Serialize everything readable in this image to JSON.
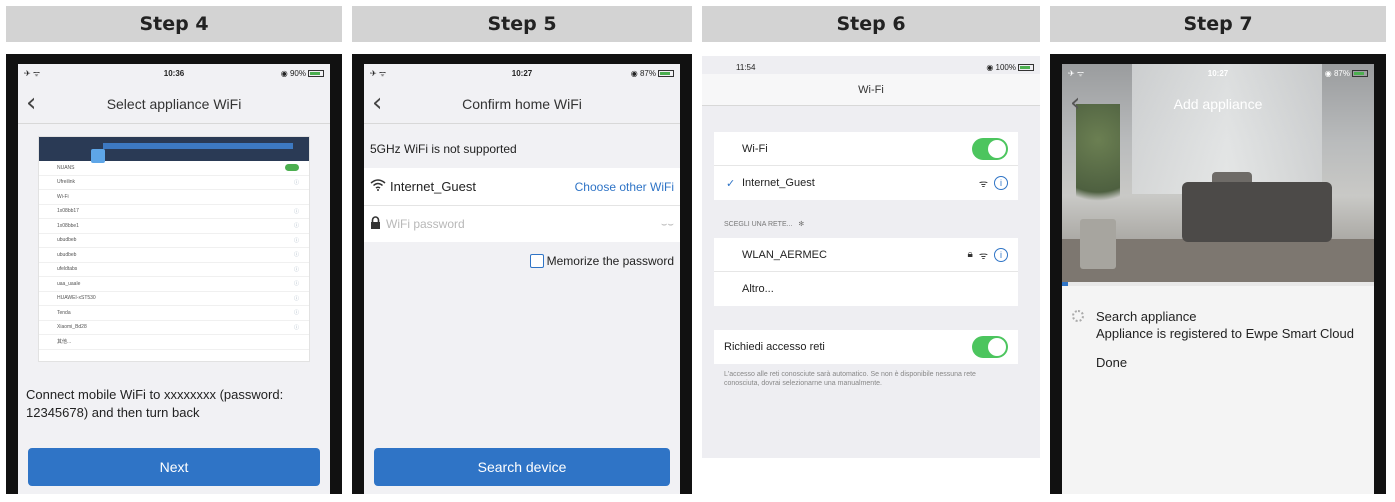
{
  "steps": [
    {
      "header": "Step 4",
      "status": {
        "left": "✈ ᯤ",
        "time": "10:36",
        "right": "◉ 90%"
      },
      "nav_title": "Select appliance WiFi",
      "mini_list": [
        "NUANS",
        "Ufreilink",
        "Wi-Fi",
        "1x08bb17",
        "1x08bbe1",
        "ubudbeb",
        "ubudbeb",
        "ufeldtabs",
        "uaa_uaale",
        "HUAWEI-xST530",
        "Tenda",
        "Xiaomi_Bd28",
        "其他..."
      ],
      "instruction": "Connect mobile WiFi to xxxxxxxx (password: 12345678) and then turn back",
      "button": "Next"
    },
    {
      "header": "Step 5",
      "status": {
        "left": "✈ ᯤ",
        "time": "10:27",
        "right": "◉ 87%"
      },
      "nav_title": "Confirm home WiFi",
      "notice": "5GHz WiFi is not supported",
      "network": "Internet_Guest",
      "choose_other": "Choose other WiFi",
      "password_placeholder": "WiFi password",
      "memorize": "Memorize the password",
      "button": "Search device"
    },
    {
      "header": "Step 6",
      "status": {
        "left": "11:54",
        "right": "◉ 100%"
      },
      "nav_title": "Wi-Fi",
      "wifi_label": "Wi-Fi",
      "connected_network": "Internet_Guest",
      "choose_network_label": "SCEGLI UNA RETE...",
      "networks": [
        "WLAN_AERMEC",
        "Altro..."
      ],
      "ask_join_label": "Richiedi accesso reti",
      "footnote": "L'accesso alle reti conosciute sarà automatico. Se non è disponibile nessuna rete conosciuta, dovrai selezionarne una manualmente."
    },
    {
      "header": "Step 7",
      "status": {
        "left": "✈ ᯤ",
        "time": "10:27",
        "right": "◉ 87%"
      },
      "nav_title": "Add appliance",
      "progress": 0.02,
      "lines": [
        "Search appliance",
        "Appliance is registered to Ewpe Smart Cloud",
        "Done"
      ]
    }
  ],
  "colors": {
    "accent": "#2f74c6",
    "toggle_on": "#4cc55e"
  },
  "icons": {
    "back": "chevron-left-icon",
    "wifi": "wifi-icon",
    "lock": "lock-icon",
    "info": "info-icon"
  }
}
